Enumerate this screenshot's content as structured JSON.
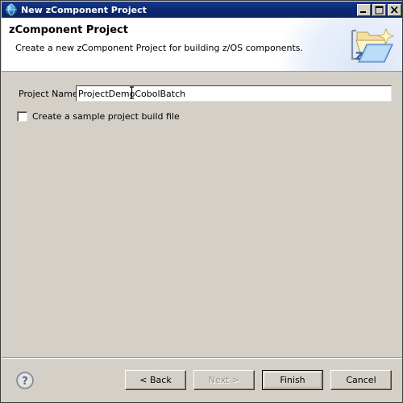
{
  "window": {
    "title": "New zComponent Project",
    "title_icon": "globe-icon",
    "controls": {
      "minimize": "minimize-icon",
      "maximize": "maximize-icon",
      "close": "close-icon"
    }
  },
  "header": {
    "title": "zComponent Project",
    "description": "Create a new zComponent Project for building z/OS components.",
    "banner_icon": "new-folder-wizard-icon"
  },
  "form": {
    "project_name": {
      "label": "Project Name:",
      "value": "ProjectDemoCobolBatch",
      "placeholder": ""
    },
    "sample_build_file": {
      "label": "Create a sample project build file",
      "checked": false
    }
  },
  "footer": {
    "help_icon": "help-question-icon",
    "buttons": [
      {
        "label": "< Back",
        "name": "back-button",
        "state": "enabled"
      },
      {
        "label": "Next >",
        "name": "next-button",
        "state": "disabled"
      },
      {
        "label": "Finish",
        "name": "finish-button",
        "state": "default"
      },
      {
        "label": "Cancel",
        "name": "cancel-button",
        "state": "enabled"
      }
    ]
  },
  "cursor": {
    "type": "text-ibeam-cursor"
  },
  "colors": {
    "titlebar": "#0d2a72",
    "dialog_face": "#d4d0c8",
    "header_bg": "#ffffff",
    "text": "#000000",
    "disabled_text": "#9b968e"
  }
}
